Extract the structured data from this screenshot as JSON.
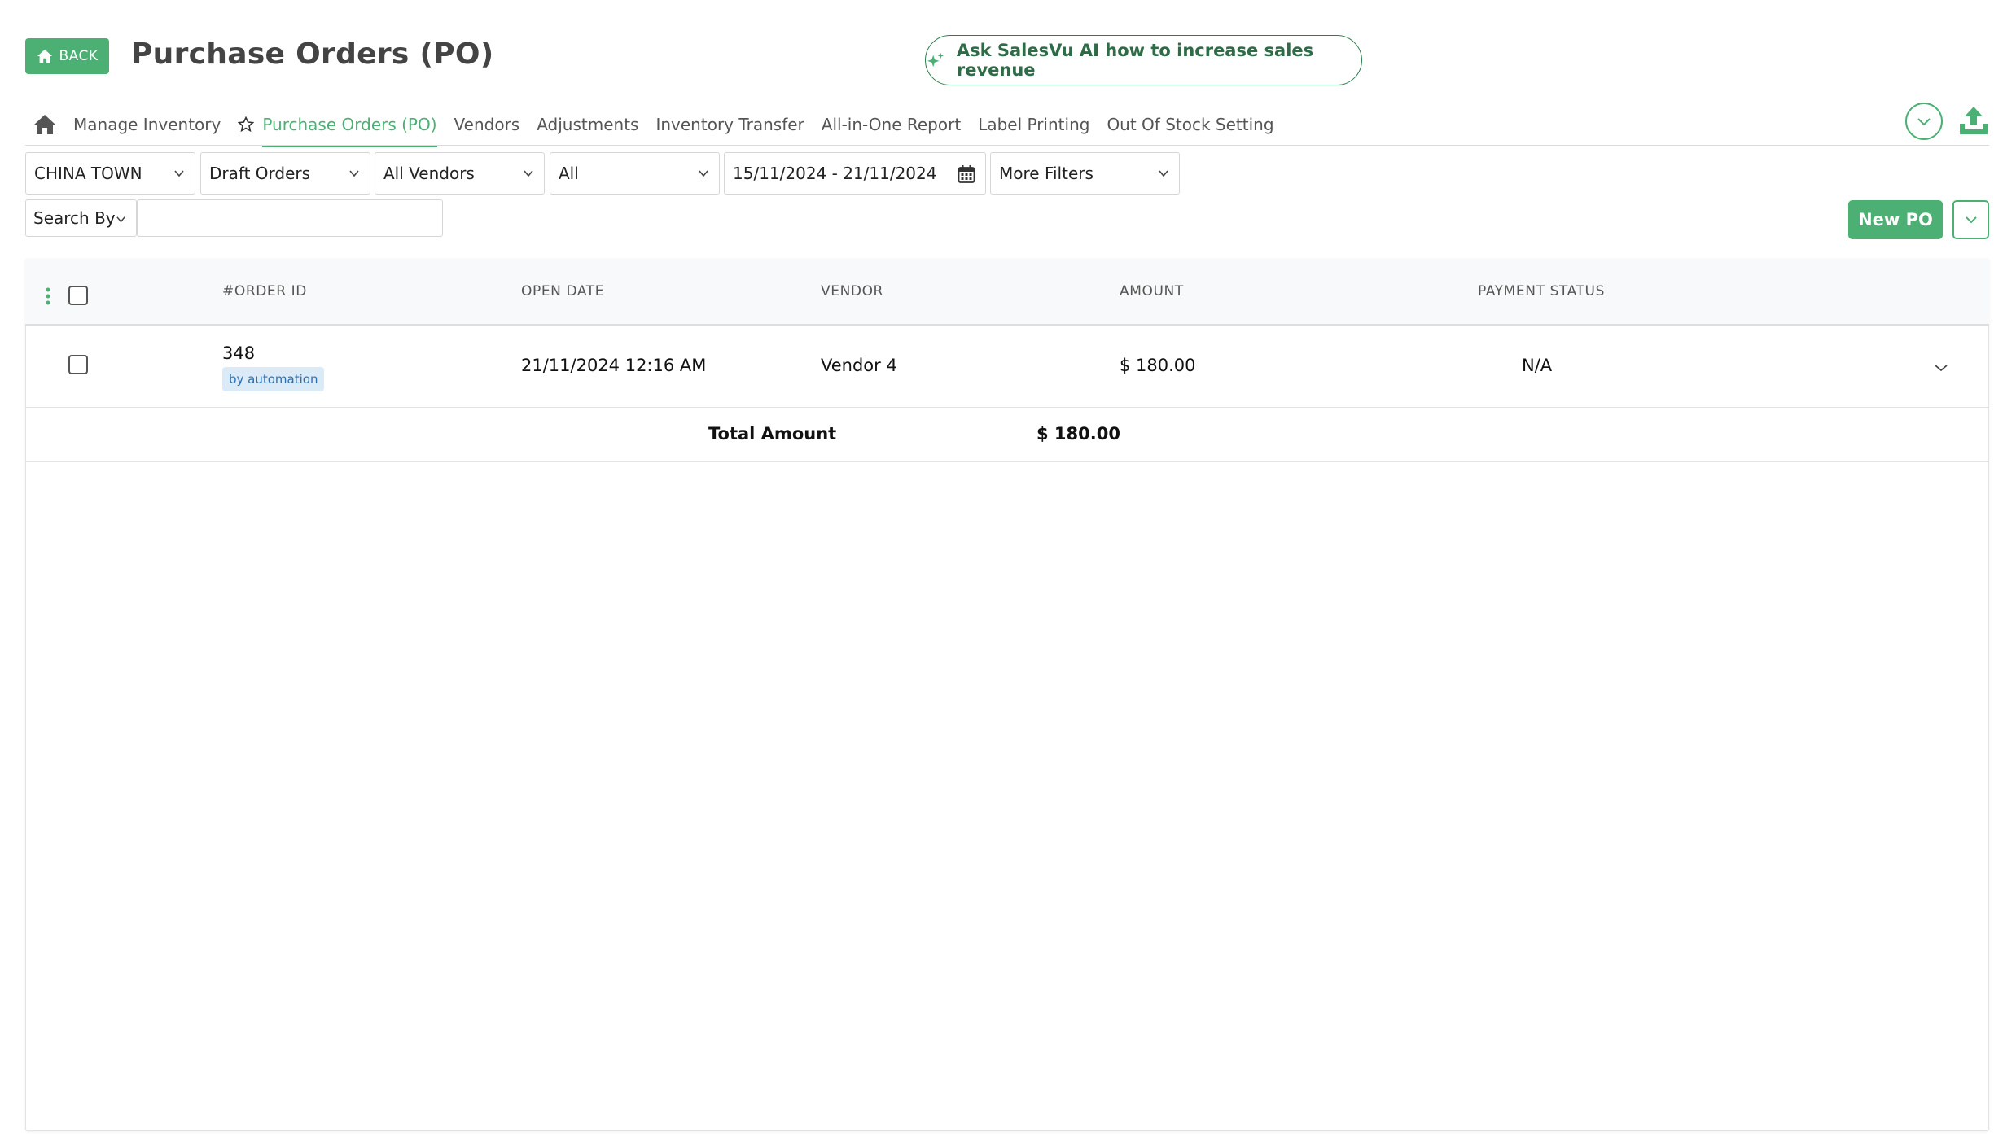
{
  "header": {
    "back_label": "BACK",
    "title": "Purchase Orders (PO)",
    "ai_button_label": "Ask SalesVu AI how to increase sales revenue"
  },
  "nav": {
    "items": [
      {
        "label": "Manage Inventory"
      },
      {
        "label": "Purchase Orders (PO)",
        "active": true
      },
      {
        "label": "Vendors"
      },
      {
        "label": "Adjustments"
      },
      {
        "label": "Inventory Transfer"
      },
      {
        "label": "All-in-One Report"
      },
      {
        "label": "Label Printing"
      },
      {
        "label": "Out Of Stock Setting"
      }
    ]
  },
  "filters": {
    "location": "CHINA TOWN",
    "order_type": "Draft Orders",
    "vendor": "All Vendors",
    "status": "All",
    "date_range": "15/11/2024 - 21/11/2024",
    "more_filters": "More Filters",
    "search_by": "Search By",
    "search_value": ""
  },
  "actions": {
    "new_po_label": "New PO"
  },
  "table": {
    "headers": [
      "#ORDER ID",
      "OPEN DATE",
      "VENDOR",
      "AMOUNT",
      "PAYMENT STATUS"
    ],
    "rows": [
      {
        "order_id": "348",
        "badge": "by automation",
        "open_date": "21/11/2024 12:16 AM",
        "vendor": "Vendor 4",
        "amount": "$ 180.00",
        "payment_status": "N/A"
      }
    ],
    "total_label": "Total Amount",
    "total_value": "$ 180.00"
  },
  "colors": {
    "accent": "#4caf73",
    "ai_border": "#2e7d4f",
    "badge_bg": "#dbeaf7",
    "badge_text": "#2c6fae"
  }
}
